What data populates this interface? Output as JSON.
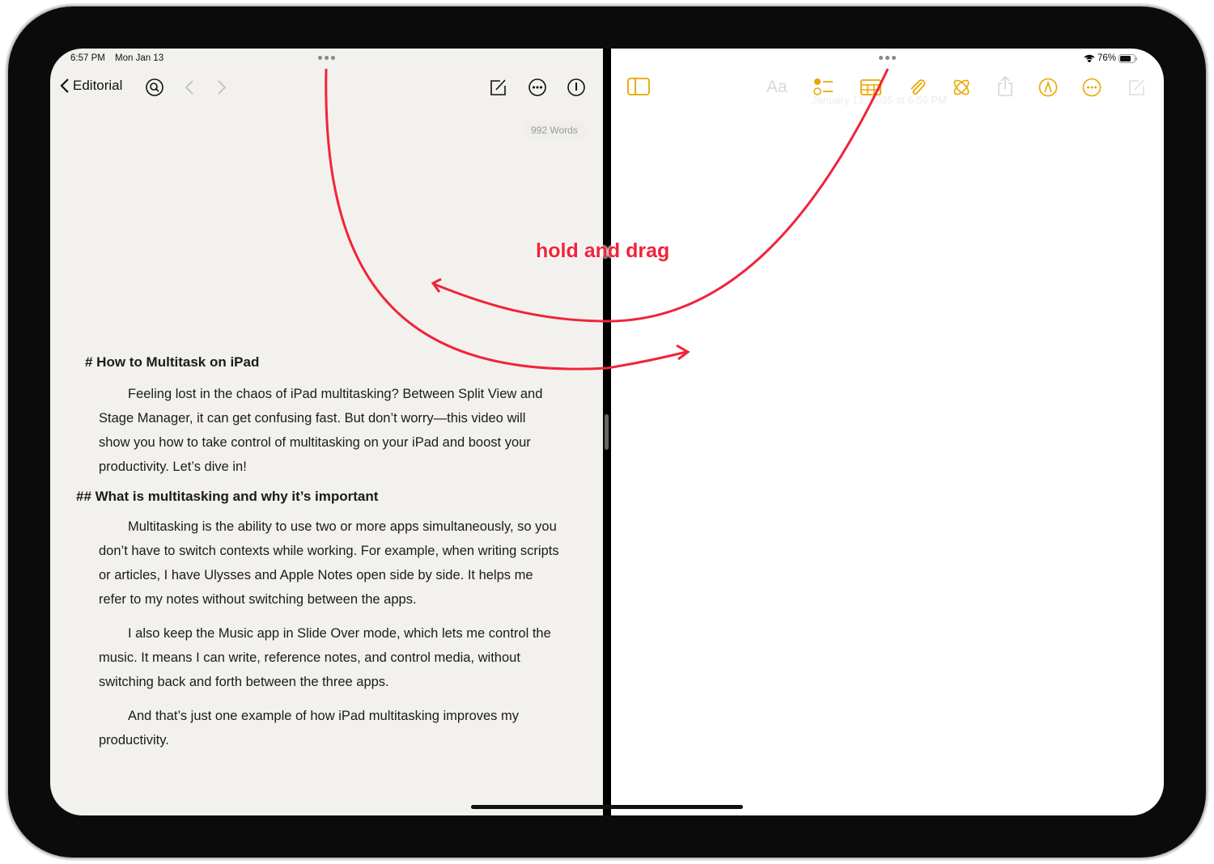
{
  "status_bar": {
    "time": "6:57 PM",
    "date": "Mon Jan 13",
    "battery": "76%"
  },
  "left_app": {
    "back_label": "Editorial",
    "word_count": "992 Words",
    "document": {
      "heading1": "# How to Multitask on iPad",
      "para1": "Feeling lost in the chaos of iPad multitasking? Between Split View and Stage Manager, it can get confusing fast. But don’t worry—this video will show you how to take control of multitasking on your iPad and boost your productivity. Let’s dive in!",
      "heading2": "## What is multitasking and why it’s important",
      "para2": "Multitasking is the ability to use two or more apps simultaneously, so you don’t have to switch contexts while working. For example, when writing scripts or articles, I have Ulysses and Apple Notes open side by side. It helps me refer to my notes without switching between the apps.",
      "para3": "I also keep the Music app in Slide Over mode, which lets me control the music. It means I can write, reference notes, and control media, without switching back and forth between the three apps.",
      "para4": "And that’s just one example of how iPad multitasking improves my productivity."
    }
  },
  "right_app": {
    "format_label": "Aa",
    "note_date": "January 13, 2025 at 6:56 PM",
    "accent": "#e8a700"
  },
  "annotation": {
    "label": "hold and drag",
    "color": "#f0243a"
  }
}
